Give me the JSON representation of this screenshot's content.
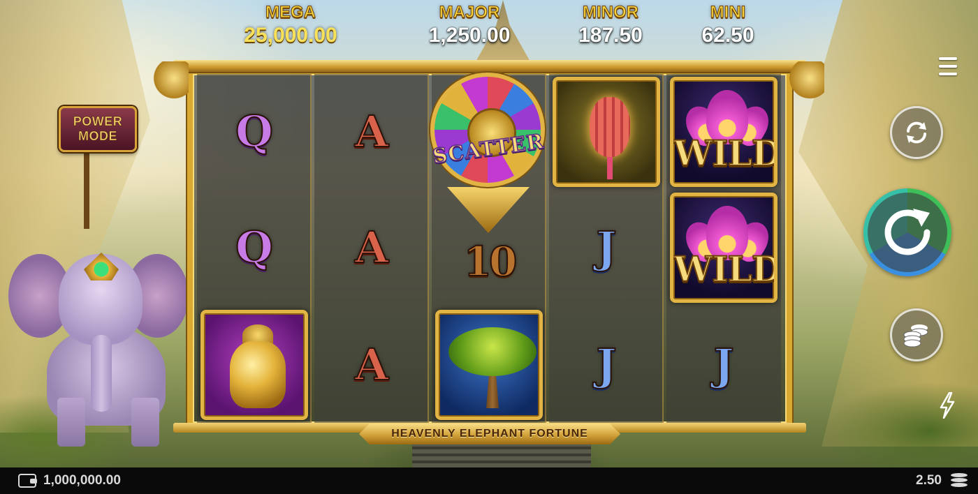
{
  "jackpots": [
    {
      "label": "MEGA",
      "value": "25,000.00"
    },
    {
      "label": "MAJOR",
      "value": "1,250.00"
    },
    {
      "label": "MINOR",
      "value": "187.50"
    },
    {
      "label": "MINI",
      "value": "62.50"
    }
  ],
  "power_mode": {
    "line1": "POWER",
    "line2": "MODE"
  },
  "reels": {
    "reel1": [
      "Q",
      "Q",
      "urn"
    ],
    "reel2": [
      "A",
      "A",
      "A"
    ],
    "reel3": [
      "scatter",
      "10",
      "tree"
    ],
    "reel4": [
      "lantern",
      "J",
      "J"
    ],
    "reel5": [
      "wild",
      "wild",
      "J"
    ],
    "scatter_label": "SCATTER",
    "wild_label": "WILD"
  },
  "game_title": "HEAVENLY ELEPHANT FORTUNE",
  "side_controls": {
    "menu_icon": "hamburger-menu-icon",
    "autoplay_icon": "autoplay-icon",
    "spin_icon": "spin-icon",
    "bet_icon": "coin-stack-icon",
    "turbo_icon": "lightning-icon"
  },
  "bottom_bar": {
    "balance": "1,000,000.00",
    "bet": "2.50",
    "balance_icon": "wallet-icon",
    "bet_icon": "coin-stack-icon"
  },
  "colors": {
    "frame_gold": "#d9a931",
    "jackpot_label": "#f6d23c",
    "spin_ring_green": "#3fbf5a",
    "spin_ring_blue": "#3a90e0"
  }
}
